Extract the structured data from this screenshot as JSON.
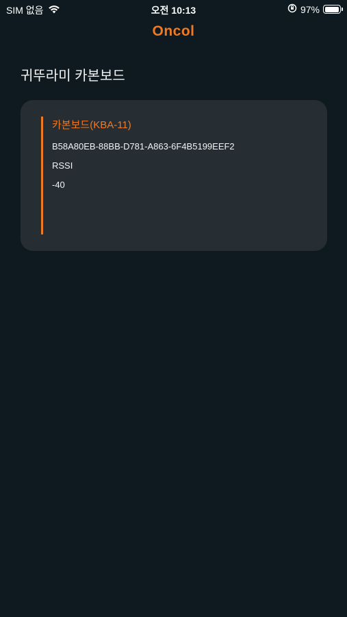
{
  "status_bar": {
    "carrier": "SIM 없음",
    "time": "오전 10:13",
    "battery_percent": "97%",
    "battery_level": 0.97,
    "icons": [
      "wifi-icon",
      "orientation-lock-icon",
      "battery-icon"
    ]
  },
  "header": {
    "logo": "Oncol"
  },
  "page": {
    "title": "귀뚜라미 카본보드"
  },
  "device": {
    "name": "카본보드(KBA-11)",
    "id": "B58A80EB-88BB-D781-A863-6F4B5199EEF2",
    "rssi_label": "RSSI",
    "rssi_value": "-40"
  },
  "colors": {
    "background": "#0f1a20",
    "card": "#262e33",
    "accent": "#f07a23",
    "text": "#f2f2f2"
  }
}
